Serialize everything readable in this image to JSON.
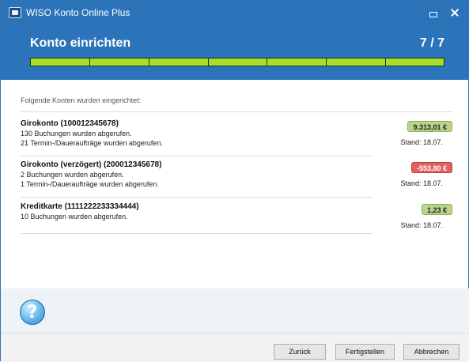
{
  "window": {
    "title": "WISO Konto Online Plus"
  },
  "header": {
    "title": "Konto einrichten",
    "step": "7 / 7",
    "progress": 1.0,
    "progress_segments": 7,
    "accent_color": "#2c74b9",
    "progress_color": "#a7de2c"
  },
  "content": {
    "intro": "Folgende Konten wurden eingerichtet:",
    "accounts": [
      {
        "name": "Girokonto (100012345678)",
        "line1": "130 Buchungen wurden abgerufen.",
        "line2": "21  Termin-/Daueraufträge wurden abgerufen.",
        "balance": "9.313,01 €",
        "balance_state": "positive",
        "stand": "Stand:  18.07."
      },
      {
        "name": "Girokonto (verzögert) (200012345678)",
        "line1": "2 Buchungen wurden abgerufen.",
        "line2": "1  Termin-/Daueraufträge wurden abgerufen.",
        "balance": "-553,80 €",
        "balance_state": "negative",
        "stand": "Stand:  18.07."
      },
      {
        "name": "Kreditkarte (1111222233334444)",
        "line1": "10 Buchungen wurden abgerufen.",
        "line2": "",
        "balance": "1,23 €",
        "balance_state": "positive",
        "stand": "Stand:  18.07."
      }
    ]
  },
  "help": {
    "icon": "help-question-icon"
  },
  "footer": {
    "back_label": "Zurück",
    "finish_label": "Fertigstellen",
    "cancel_label": "Abbrechen"
  },
  "colors": {
    "positive_badge": "#b7d48a",
    "negative_badge": "#e45f62"
  }
}
